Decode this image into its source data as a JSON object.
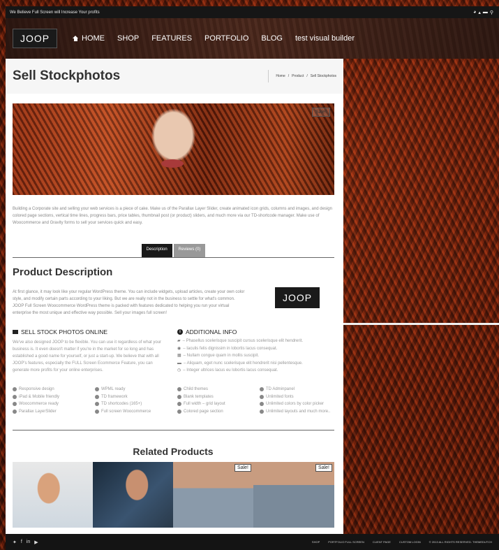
{
  "topbar": {
    "text": "We Believe Full Screen will Increase Your profits"
  },
  "nav": {
    "logo": "JOOP",
    "items": [
      "HOME",
      "SHOP",
      "FEATURES",
      "PORTFOLIO",
      "BLOG",
      "test visual builder"
    ]
  },
  "page": {
    "title": "Sell Stockphotos",
    "breadcrumb": [
      "Home",
      "/",
      "Product",
      "/",
      "Sell Stockphotos"
    ],
    "hero_badge": "Sale!",
    "intro": "Building a Corporate site and selling your web services is a piece of cake. Make us of the Parallax Layer Slider, create animated icon grids, columns and images, and design colored page sections, vertical time lines, progress bars, price tables, thumbnail post (or product) sliders, and much more via our TD-shortcode manager. Make use of Woocommerce and Gravity forms to sell your services quick and easy."
  },
  "tabs": [
    "Description",
    "Reviews (0)"
  ],
  "description": {
    "title": "Product Description",
    "text": "At first glance, it may look like your regular WordPress theme. You can include widgets, upload articles, create your own color style, and modify certain parts according to your liking. But we are really not in the business to settle for what's common. JOOP Full Screen Woocommerce WordPress theme is packed with features dedicated to helping you run your virtual enterprise the most unique and effective way possible. Sell your images full screen!",
    "badge": "JOOP"
  },
  "sell": {
    "title": "SELL STOCK PHOTOS ONLINE",
    "text": "We've also designed JOOP to be flexible. You can use it regardless of what your business is. It even doesn't matter if you're in the market for so long and has established a good name for yourself, or just a start-up. We believe that with all JOOP's features, especially the FULL Screen Ecommerce Feature, you can generate more profits for your online enterprises."
  },
  "additional": {
    "title": "ADDITIONAL INFO",
    "items": [
      "– Phasellus scelerisque suscipit cursus scelerisque elit hendrerit.",
      "– Iaculis felis dignissim in lobortis lacus consequat.",
      "– Nullam congue quam in mollis suscipit.",
      "– Aliquam, eget nunc scelerisque elit hendrerit nisi pellentesque.",
      "– Integer ultrices lacus eu lobortis lacus consequat."
    ]
  },
  "features": {
    "col1": [
      "Responsive design",
      "iPad & Mobile friendly",
      "Woocommerce ready",
      "Parallax LayerSlider"
    ],
    "col2": [
      "WPML ready",
      "TD framework",
      "TD shortcodes (165+)",
      "Full screen Woocommerce"
    ],
    "col3": [
      "Child themes",
      "Blank templates",
      "Full width – grid layout",
      "Colored page section"
    ],
    "col4": [
      "TD Adminpanel",
      "Unlimited fonts",
      "Unlimited colors by color picker",
      "Unlimited layouts and much more.."
    ]
  },
  "related": {
    "title": "Related Products",
    "sale": "Sale!"
  },
  "footer": {
    "links": [
      "SHOP",
      "PORTFOLIO FULL SCREEN",
      "CLIENT PAGE",
      "CUSTOM LOGIN"
    ],
    "copyright": "© 2013 ALL RIGHTS RESERVED. THEMEDUTCH"
  }
}
